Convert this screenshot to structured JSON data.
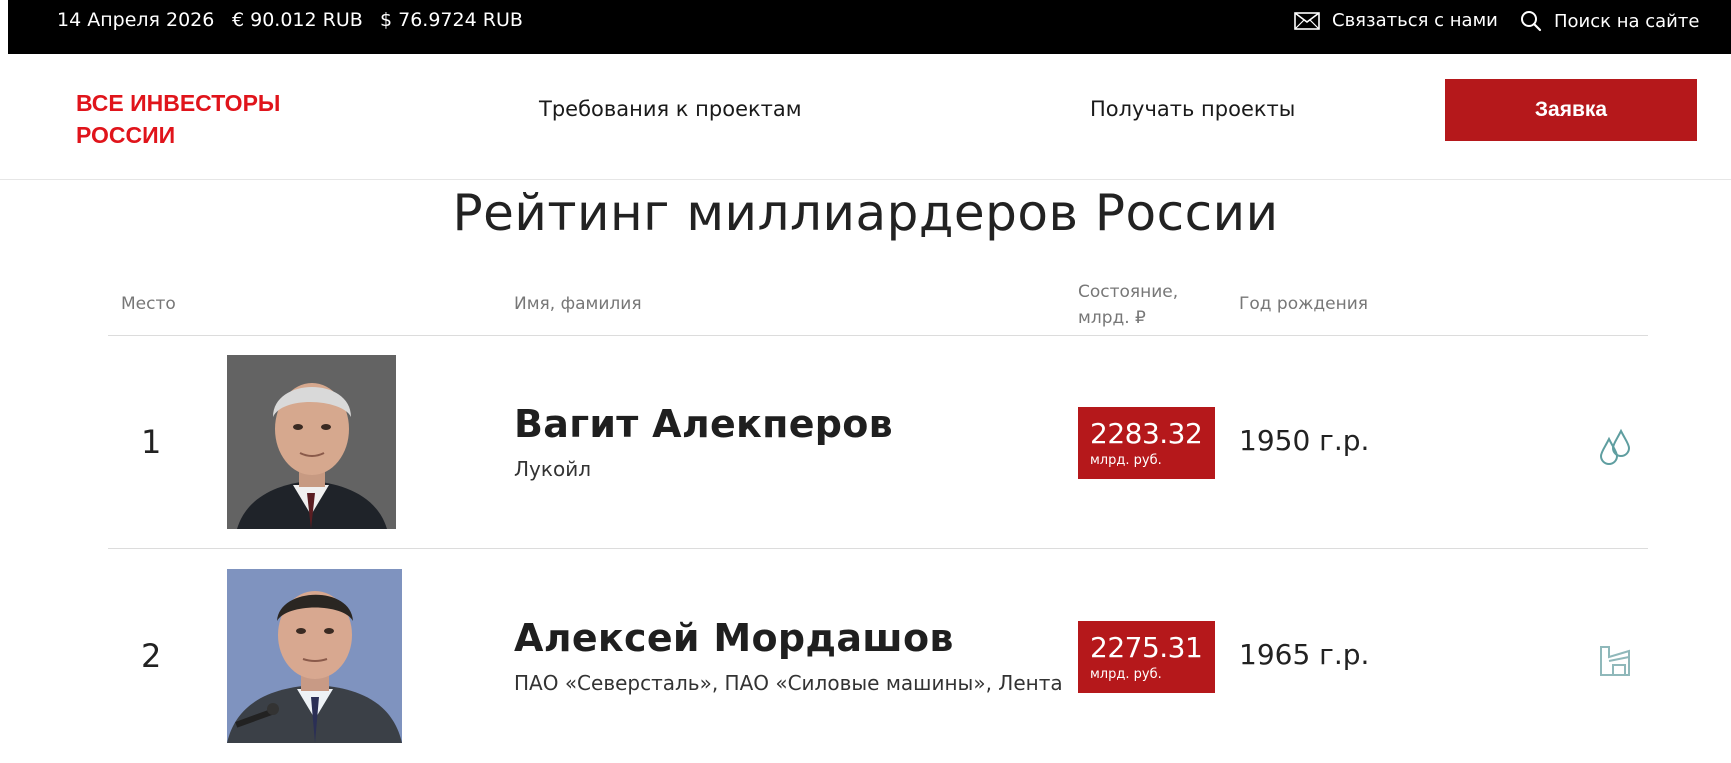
{
  "topbar": {
    "date": "14 Апреля 2026",
    "eur_rate": "€ 90.012 RUB",
    "usd_rate": "$ 76.9724 RUB",
    "contact_label": "Связаться с нами",
    "search_label": "Поиск на сайте",
    "contact_icon": "mail-icon",
    "search_icon": "search-icon"
  },
  "header": {
    "logo_line1": "ВСЕ ИНВЕСТОРЫ",
    "logo_line2": "РОССИИ",
    "nav_requirements": "Требования к проектам",
    "nav_get_projects": "Получать проекты",
    "apply_button": "Заявка"
  },
  "page": {
    "title": "Рейтинг миллиардеров России"
  },
  "table": {
    "columns": {
      "place": "Место",
      "name": "Имя, фамилия",
      "worth_line1": "Состояние,",
      "worth_line2": "млрд. ₽",
      "birth_year": "Год рождения"
    },
    "rows": [
      {
        "rank": "1",
        "name": "Вагит Алекперов",
        "company": "Лукойл",
        "worth": "2283.32",
        "worth_unit": "млрд. руб.",
        "birth_year": "1950 г.р.",
        "industry_icon": "oil-drops-icon"
      },
      {
        "rank": "2",
        "name": "Алексей Мордашов",
        "company": "ПАО «Северсталь», ПАО «Силовые машины», Лента",
        "worth": "2275.31",
        "worth_unit": "млрд. руб.",
        "birth_year": "1965 г.р.",
        "industry_icon": "factory-icon"
      }
    ]
  },
  "colors": {
    "accent": "#b5181b",
    "logo": "#e0141b",
    "topbar": "#000000",
    "icon": "#5f9ea0"
  }
}
